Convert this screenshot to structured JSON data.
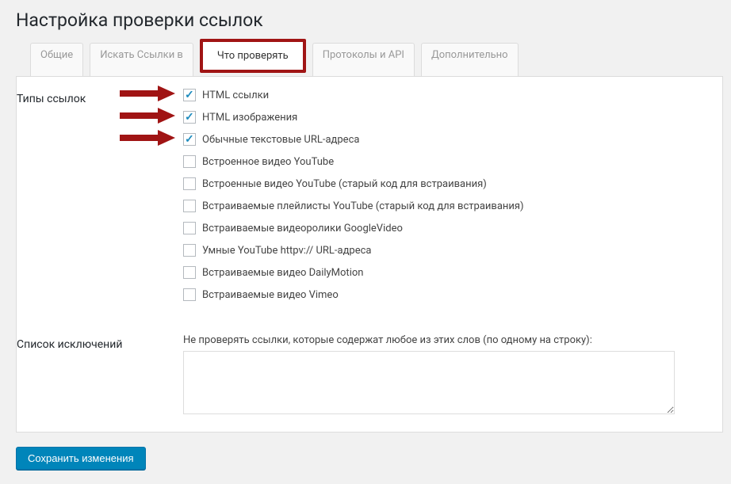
{
  "page_title": "Настройка проверки ссылок",
  "tabs": {
    "general": "Общие",
    "search_links": "Искать Ссылки в",
    "what_check": "Что проверять",
    "protocols": "Протоколы и API",
    "advanced": "Дополнительно"
  },
  "section": {
    "link_types": "Типы ссылок",
    "exclusions": "Список исключений"
  },
  "items": {
    "html_links": "HTML ссылки",
    "html_images": "HTML изображения",
    "plain_url": "Обычные текстовые URL-адреса",
    "yt_embedded": "Встроенное видео YouTube",
    "yt_embedded_old": "Встроенные видео YouTube (старый код для встраивания)",
    "yt_playlist_old": "Встраиваемые плейлисты YouTube (старый код для встраивания)",
    "googlevideo": "Встраиваемые видеоролики GoogleVideo",
    "yt_smart": "Умные YouTube httpv:// URL-адреса",
    "dailymotion": "Встраиваемые видео DailyMotion",
    "vimeo": "Встраиваемые видео Vimeo"
  },
  "exclusion_desc": "Не проверять ссылки, которые содержат любое из этих слов (по одному на строку):",
  "save_button": "Сохранить изменения"
}
